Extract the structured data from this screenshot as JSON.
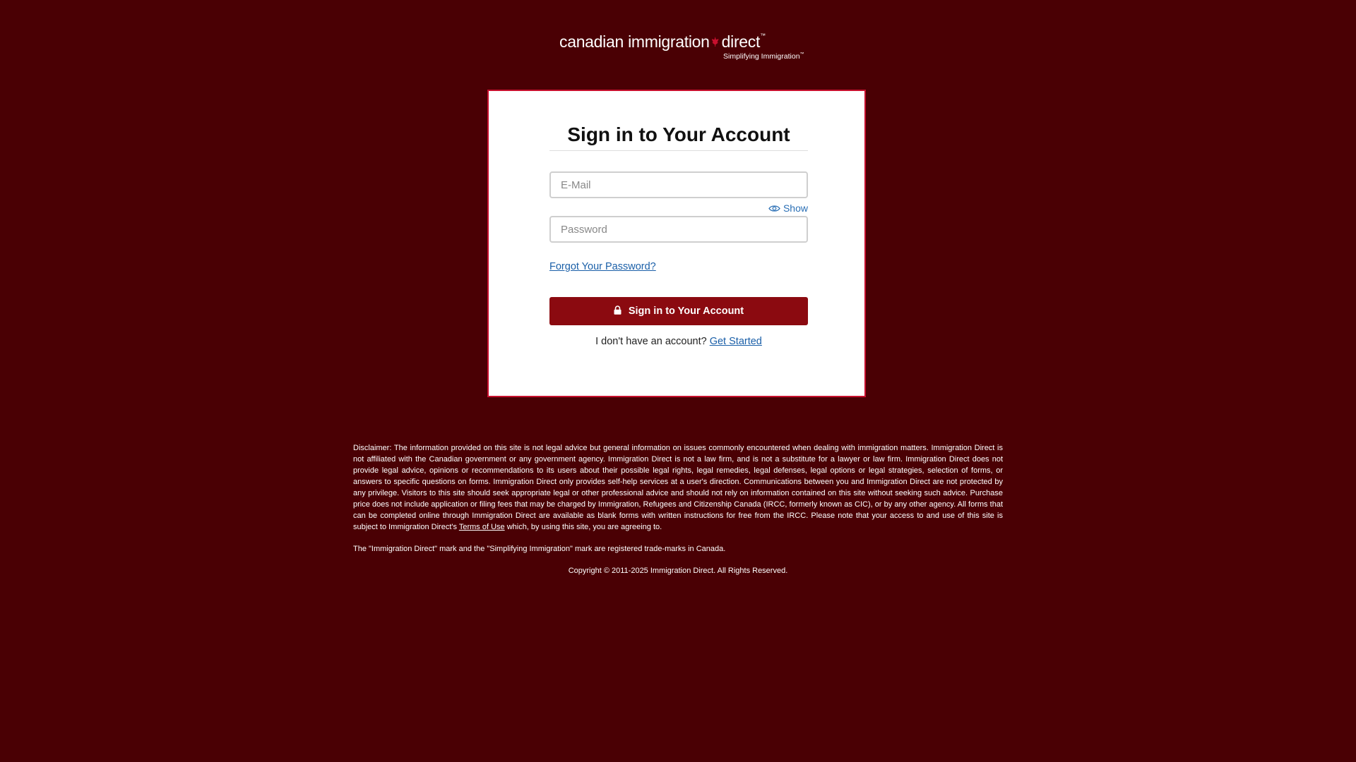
{
  "logo": {
    "word_canadian": "canadian",
    "word_immigration": "immigration",
    "word_direct": "direct",
    "trademark_mark": "™",
    "tagline": "Simplifying Immigration",
    "tagline_trademark_mark": "™",
    "leaf_color": "#c8102e"
  },
  "signin": {
    "title": "Sign in to Your Account",
    "email_placeholder": "E-Mail",
    "email_value": "",
    "password_placeholder": "Password",
    "password_value": "",
    "show_label": "Show",
    "show_icon": "eye-icon",
    "forgot_password": "Forgot Your Password?",
    "button_label": "Sign in to Your Account",
    "button_icon": "lock-icon",
    "no_account_text": "I don't have an account?",
    "get_started": "Get Started"
  },
  "colors": {
    "background": "#4a0004",
    "accent": "#8b0a10",
    "card_border": "#c8102e",
    "link": "#1a5fa8"
  },
  "footer": {
    "disclaimer_before": "Disclaimer: The information provided on this site is not legal advice but general information on issues commonly encountered when dealing with immigration matters. Immigration Direct is not affiliated with the Canadian government or any government agency. Immigration Direct is not a law firm, and is not a substitute for a lawyer or law firm. Immigration Direct does not provide legal advice, opinions or recommendations to its users about their possible legal rights, legal remedies, legal defenses, legal options or legal strategies, selection of forms, or answers to specific questions on forms. Immigration Direct only provides self-help services at a user's direction. Communications between you and Immigration Direct are not protected by any privilege. Visitors to this site should seek appropriate legal or other professional advice and should not rely on information contained on this site without seeking such advice. Purchase price does not include application or filing fees that may be charged by Immigration, Refugees and Citizenship Canada (IRCC, formerly known as CIC), or by any other agency. All forms that can be completed online through Immigration Direct are available as blank forms with written instructions for free from the IRCC. Please note that your access to and use of this site is subject to Immigration Direct's ",
    "terms_link": "Terms of Use",
    "disclaimer_after": " which, by using this site, you are agreeing to.",
    "trademark": "The \"Immigration Direct\" mark and the \"Simplifying Immigration\" mark are registered trade-marks in Canada.",
    "copyright": "Copyright © 2011-2025 Immigration Direct. All Rights Reserved."
  }
}
